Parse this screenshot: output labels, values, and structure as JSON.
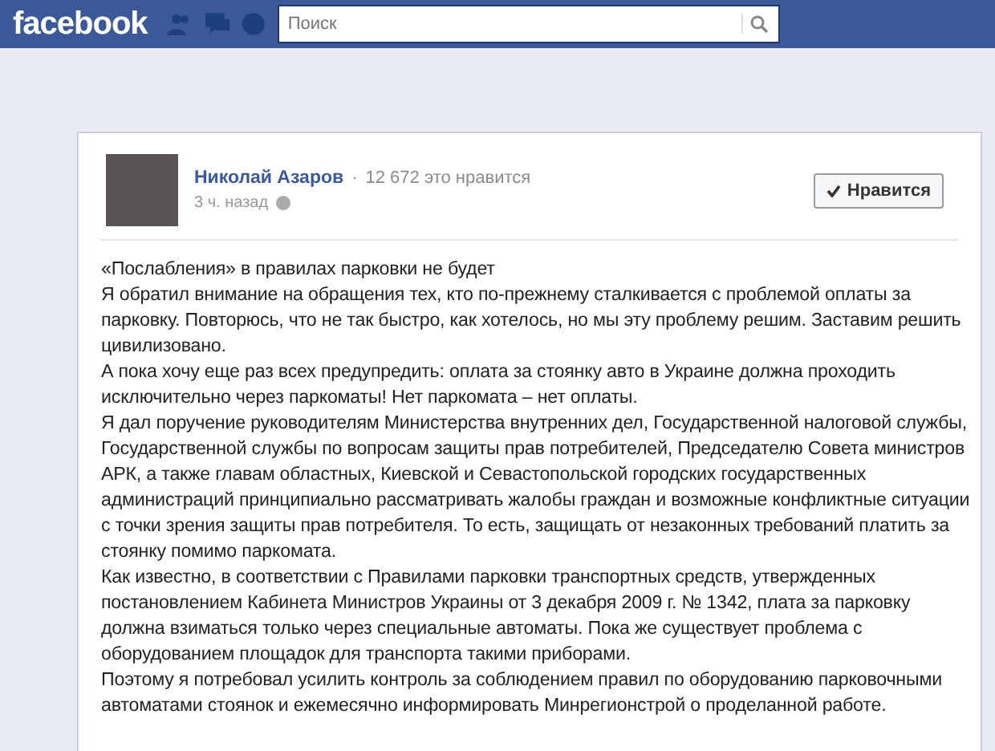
{
  "topbar": {
    "logo": "facebook",
    "search": {
      "placeholder": "Поиск"
    }
  },
  "post": {
    "author": "Николай Азаров",
    "separator": "·",
    "likes_count": "12 672 это нравится",
    "time": "3 ч. назад",
    "like_button": {
      "label": "Нравится",
      "liked": true
    },
    "paragraphs": [
      "«Послабления» в правилах парковки не будет",
      "Я обратил внимание на обращения тех, кто по-прежнему сталкивается с проблемой оплаты за парковку. Повторюсь, что не так быстро, как хотелось, но мы эту проблему решим. Заставим решить цивилизовано.",
      "А пока хочу еще раз всех предупредить: оплата за стоянку авто в Украине должна проходить исключительно через паркоматы! Нет паркомата – нет оплаты.",
      "Я дал поручение руководителям Министерства внутренних дел, Государственной налоговой службы, Государственной службы по вопросам защиты прав потребителей, Председателю Совета министров АРК, а также главам областных, Киевской и Севастопольской городских государственных администраций принципиально рассматривать жалобы граждан и возможные конфликтные ситуации с точки зрения защиты прав потребителя. То есть, защищать от незаконных требований платить за стоянку помимо паркомата.",
      "Как известно, в соответствии с Правилами парковки транспортных средств, утвержденных постановлением Кабинета Министров Украины от 3 декабря 2009 г. № 1342, плата за парковку должна взиматься только через специальные автоматы. Пока же существует проблема с оборудованием площадок для транспорта такими приборами.",
      "Поэтому я потребовал усилить контроль за соблюдением правил по оборудованию парковочными автоматами стоянок и ежемесячно информировать Минрегионстрой о проделанной работе."
    ]
  }
}
